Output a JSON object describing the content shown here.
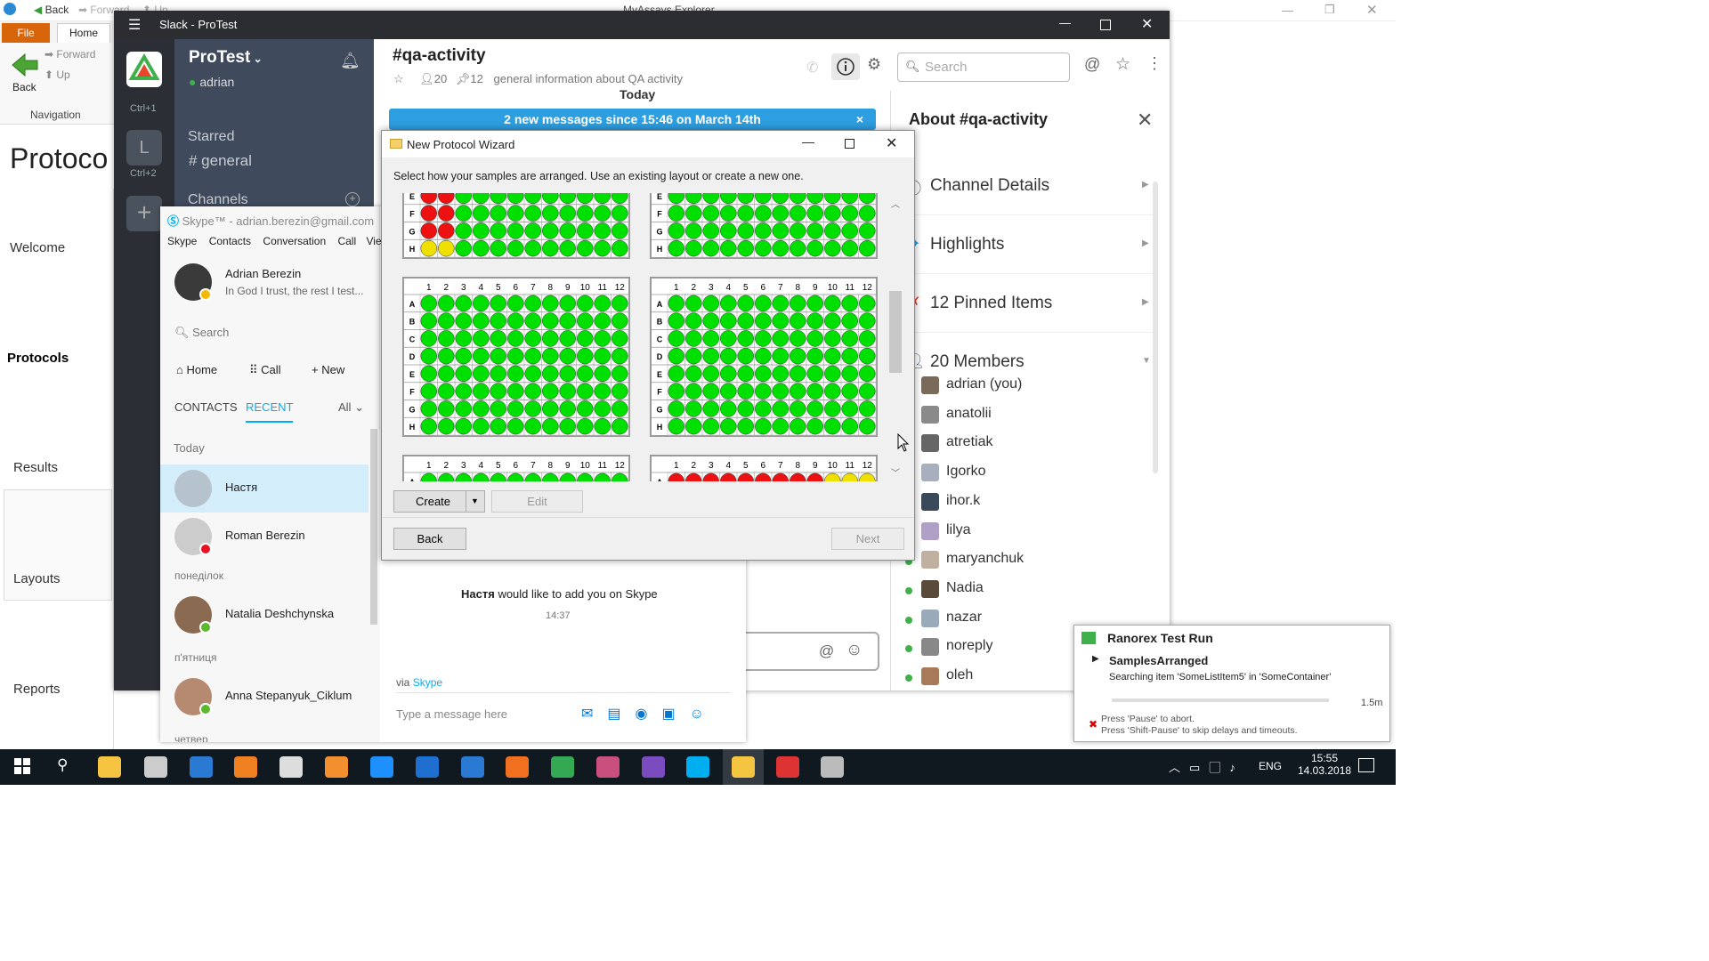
{
  "explorer": {
    "window_title": "MyAssays Explorer",
    "qa_back": "Back",
    "qa_forward": "Forward",
    "qa_up": "Up",
    "tab_file": "File",
    "tab_home": "Home",
    "nav_back": "Back",
    "nav_forward": "Forward",
    "nav_up": "Up",
    "nav_group": "Navigation",
    "heading": "Protoco",
    "sidebar": [
      "Welcome",
      "Protocols",
      "Results",
      "Layouts",
      "Reports"
    ]
  },
  "slack": {
    "window_title": "Slack - ProTest",
    "team_shortcut_1": "Ctrl+1",
    "team_letter_2": "L",
    "team_shortcut_2": "Ctrl+2",
    "workspace": "ProTest",
    "user": "adrian",
    "starred_label": "Starred",
    "starred_channel": "# general",
    "channels_label": "Channels",
    "channel_name": "#qa-activity",
    "member_count": "20",
    "pinned_count": "12",
    "topic": "general information about QA activity",
    "day_label": "Today",
    "banner": "2 new messages since 15:46 on March 14th",
    "search_placeholder": "Search",
    "about_title": "About #qa-activity",
    "details": [
      "Channel Details",
      "Highlights",
      "12 Pinned Items",
      "20 Members"
    ],
    "members": [
      "adrian (you)",
      "anatolii",
      "atretiak",
      "Igorko",
      "ihor.k",
      "lilya",
      "maryanchuk",
      "Nadia",
      "nazar",
      "noreply",
      "oleh"
    ]
  },
  "skype": {
    "title": "Skype™ - adrian.berezin@gmail.com",
    "menu": [
      "Skype",
      "Contacts",
      "Conversation",
      "Call",
      "View"
    ],
    "profile_name": "Adrian Berezin",
    "profile_status": "In God I trust, the rest I test...",
    "search_placeholder": "Search",
    "home": "Home",
    "call": "Call",
    "new": "New",
    "tab_contacts": "CONTACTS",
    "tab_recent": "RECENT",
    "filter": "All",
    "groups": [
      "Today",
      "понеділок",
      "п'ятниця",
      "четвер"
    ],
    "contacts": [
      "Настя",
      "Roman Berezin",
      "Natalia Deshchynska",
      "Anna Stepanyuk_Ciklum"
    ],
    "chat_message_name": "Настя",
    "chat_message_text": "would like to add you on Skype",
    "chat_time": "14:37",
    "via": "via",
    "via_link": "Skype",
    "message_placeholder": "Type a message here"
  },
  "wizard": {
    "title": "New Protocol Wizard",
    "instruction": "Select how your samples are arranged. Use an existing layout or create a new one.",
    "create": "Create",
    "edit": "Edit",
    "back": "Back",
    "next": "Next",
    "rows": [
      "A",
      "B",
      "C",
      "D",
      "E",
      "F",
      "G",
      "H"
    ],
    "cols": [
      "1",
      "2",
      "3",
      "4",
      "5",
      "6",
      "7",
      "8",
      "9",
      "10",
      "11",
      "12"
    ]
  },
  "ranorex": {
    "title": "Ranorex Test Run",
    "step": "SamplesArranged",
    "detail": "Searching item 'SomeListItem5' in 'SomeContainer'",
    "timer": "1.5m",
    "hint1": "Press 'Pause' to abort.",
    "hint2": "Press 'Shift-Pause' to skip delays and timeouts."
  },
  "taskbar": {
    "lang": "ENG",
    "time": "15:55",
    "date": "14.03.2018"
  }
}
